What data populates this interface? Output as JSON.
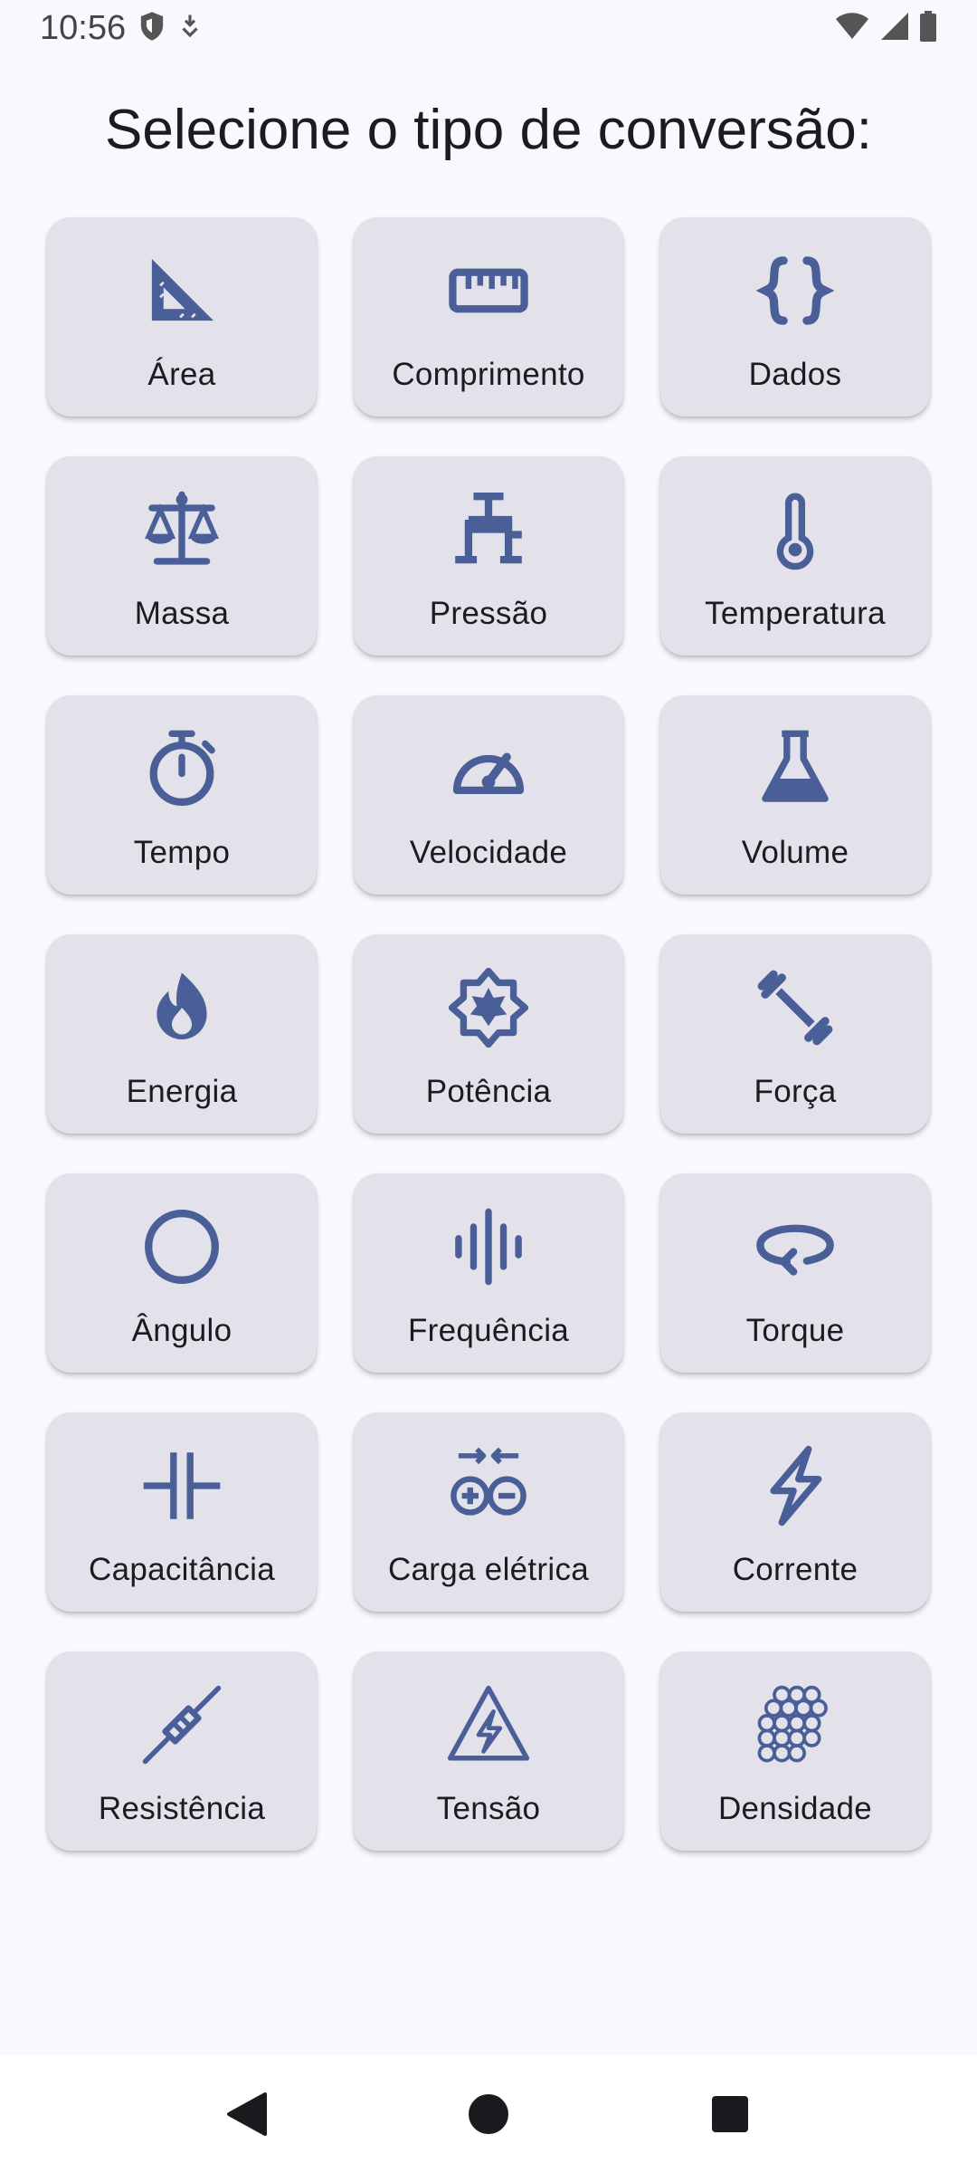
{
  "status_bar": {
    "time": "10:56",
    "icons": [
      "shield-icon",
      "download-icon",
      "wifi-icon",
      "signal-icon",
      "battery-icon"
    ]
  },
  "title": "Selecione o tipo de conversão:",
  "accent_color": "#4a5f97",
  "tiles": [
    {
      "label": "Área",
      "icon": "set-square-icon"
    },
    {
      "label": "Comprimento",
      "icon": "ruler-icon"
    },
    {
      "label": "Dados",
      "icon": "curly-braces-icon"
    },
    {
      "label": "Massa",
      "icon": "scale-balance-icon"
    },
    {
      "label": "Pressão",
      "icon": "pressure-valve-icon"
    },
    {
      "label": "Temperatura",
      "icon": "thermometer-icon"
    },
    {
      "label": "Tempo",
      "icon": "stopwatch-icon"
    },
    {
      "label": "Velocidade",
      "icon": "speedometer-icon"
    },
    {
      "label": "Volume",
      "icon": "flask-icon"
    },
    {
      "label": "Energia",
      "icon": "flame-icon"
    },
    {
      "label": "Potência",
      "icon": "power-star-icon"
    },
    {
      "label": "Força",
      "icon": "dumbbell-icon"
    },
    {
      "label": "Ângulo",
      "icon": "circle-icon"
    },
    {
      "label": "Frequência",
      "icon": "waveform-icon"
    },
    {
      "label": "Torque",
      "icon": "rotate-icon"
    },
    {
      "label": "Capacitância",
      "icon": "capacitor-icon"
    },
    {
      "label": "Carga elétrica",
      "icon": "charge-icon"
    },
    {
      "label": "Corrente",
      "icon": "lightning-icon"
    },
    {
      "label": "Resistência",
      "icon": "resistor-icon"
    },
    {
      "label": "Tensão",
      "icon": "high-voltage-icon"
    },
    {
      "label": "Densidade",
      "icon": "atoms-icon"
    }
  ],
  "nav_bar": {
    "buttons": [
      "back-icon",
      "home-icon",
      "recents-icon"
    ]
  }
}
